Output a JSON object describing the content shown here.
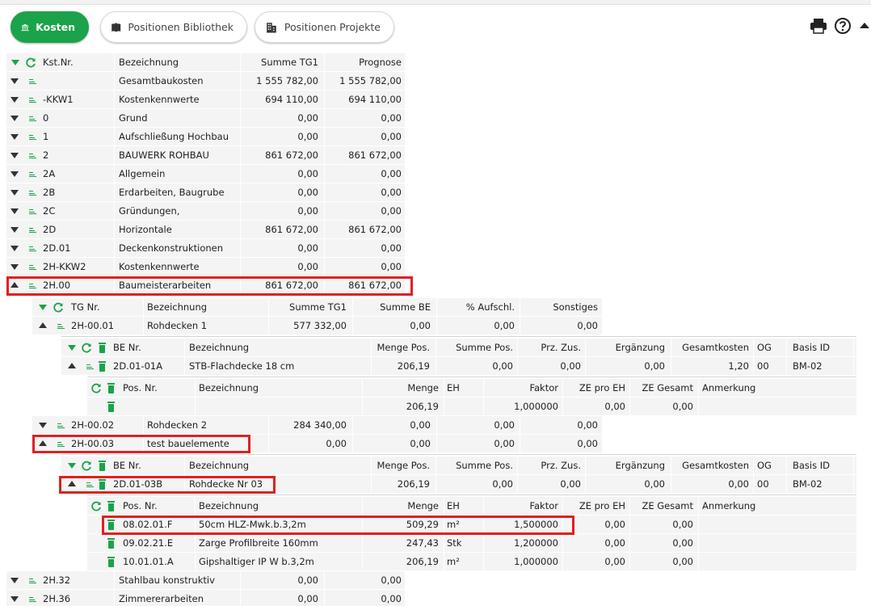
{
  "toolbar": {
    "kosten": "Kosten",
    "bibliothek": "Positionen Bibliothek",
    "projekte": "Positionen Projekte",
    "accent": "#1aa34a"
  },
  "kst_header": {
    "nr": "Kst.Nr.",
    "bez": "Bezeichnung",
    "summe": "Summe TG1",
    "prognose": "Prognose"
  },
  "kst_rows": [
    {
      "nr": "",
      "bez": "Gesamtbaukosten",
      "summe": "1 555 782,00",
      "prognose": "1 555 782,00"
    },
    {
      "nr": "-KKW1",
      "bez": "Kostenkennwerte",
      "summe": "694 110,00",
      "prognose": "694 110,00"
    },
    {
      "nr": "0",
      "bez": "Grund",
      "summe": "0,00",
      "prognose": "0,00"
    },
    {
      "nr": "1",
      "bez": "Aufschließung Hochbau",
      "summe": "0,00",
      "prognose": "0,00"
    },
    {
      "nr": "2",
      "bez": "BAUWERK ROHBAU",
      "summe": "861 672,00",
      "prognose": "861 672,00"
    },
    {
      "nr": "2A",
      "bez": "Allgemein",
      "summe": "0,00",
      "prognose": "0,00"
    },
    {
      "nr": "2B",
      "bez": "Erdarbeiten, Baugrube",
      "summe": "0,00",
      "prognose": "0,00"
    },
    {
      "nr": "2C",
      "bez": "Gründungen,",
      "summe": "0,00",
      "prognose": "0,00"
    },
    {
      "nr": "2D",
      "bez": "Horizontale",
      "summe": "861 672,00",
      "prognose": "861 672,00"
    },
    {
      "nr": "2D.01",
      "bez": "Deckenkonstruktionen",
      "summe": "0,00",
      "prognose": "0,00"
    },
    {
      "nr": "2H-KKW2",
      "bez": "Kostenkennwerte",
      "summe": "0,00",
      "prognose": "0,00"
    },
    {
      "nr": "2H.00",
      "bez": "Baumeisterarbeiten",
      "summe": "861 672,00",
      "prognose": "861 672,00"
    }
  ],
  "kst_tail": [
    {
      "nr": "2H.32",
      "bez": "Stahlbau konstruktiv",
      "summe": "0,00",
      "prognose": "0,00"
    },
    {
      "nr": "2H.36",
      "bez": "Zimmererarbeiten",
      "summe": "0,00",
      "prognose": "0,00"
    }
  ],
  "tg_header": {
    "nr": "TG Nr.",
    "bez": "Bezeichnung",
    "summe": "Summe TG1",
    "summe_be": "Summe BE",
    "aufschl": "% Aufschl.",
    "sonstiges": "Sonstiges"
  },
  "tg_rows": [
    {
      "nr": "2H-00.01",
      "bez": "Rohdecken 1",
      "summe": "577 332,00",
      "summe_be": "0,00",
      "aufschl": "0,00",
      "sonstiges": "0,00"
    },
    {
      "nr": "2H-00.02",
      "bez": "Rohdecken 2",
      "summe": "284 340,00",
      "summe_be": "0,00",
      "aufschl": "0,00",
      "sonstiges": "0,00"
    },
    {
      "nr": "2H-00.03",
      "bez": "test bauelemente",
      "summe": "0,00",
      "summe_be": "0,00",
      "aufschl": "0,00",
      "sonstiges": "0,00"
    }
  ],
  "be_header": {
    "nr": "BE Nr.",
    "bez": "Bezeichnung",
    "menge": "Menge Pos.",
    "summe": "Summe Pos.",
    "prz": "Prz. Zus.",
    "erg": "Ergänzung",
    "gesamt": "Gesamtkosten",
    "og": "OG",
    "basis": "Basis ID"
  },
  "be1": {
    "nr": "2D.01-01A",
    "bez": "STB-Flachdecke 18 cm",
    "menge": "206,19",
    "summe": "0,00",
    "prz": "0,00",
    "erg": "0,00",
    "gesamt": "1,20",
    "og": "00",
    "basis": "BM-02"
  },
  "be2": {
    "nr": "2D.01-03B",
    "bez": "Rohdecke Nr 03",
    "menge": "206,19",
    "summe": "0,00",
    "prz": "0,00",
    "erg": "0,00",
    "gesamt": "0,00",
    "og": "00",
    "basis": "BM-02"
  },
  "pos_header": {
    "nr": "Pos. Nr.",
    "bez": "Bezeichnung",
    "menge": "Menge",
    "eh": "EH",
    "faktor": "Faktor",
    "ze_eh": "ZE pro EH",
    "ze_ges": "ZE Gesamt",
    "anm": "Anmerkung"
  },
  "pos1": {
    "nr": "",
    "bez": "",
    "menge": "206,19",
    "eh": "",
    "faktor": "1,000000",
    "ze_eh": "0,00",
    "ze_ges": "0,00"
  },
  "pos2": [
    {
      "nr": "08.02.01.F",
      "bez": "50cm HLZ-Mwk.b.3,2m",
      "menge": "509,29",
      "eh": "m²",
      "faktor": "1,500000",
      "ze_eh": "0,00",
      "ze_ges": "0,00"
    },
    {
      "nr": "09.02.21.E",
      "bez": "Zarge Profilbreite 160mm",
      "menge": "247,43",
      "eh": "Stk",
      "faktor": "1,200000",
      "ze_eh": "0,00",
      "ze_ges": "0,00"
    },
    {
      "nr": "10.01.01.A",
      "bez": "Gipshaltiger IP W b.3,2m",
      "menge": "206,19",
      "eh": "m²",
      "faktor": "1,000000",
      "ze_eh": "0,00",
      "ze_ges": "0,00"
    }
  ]
}
